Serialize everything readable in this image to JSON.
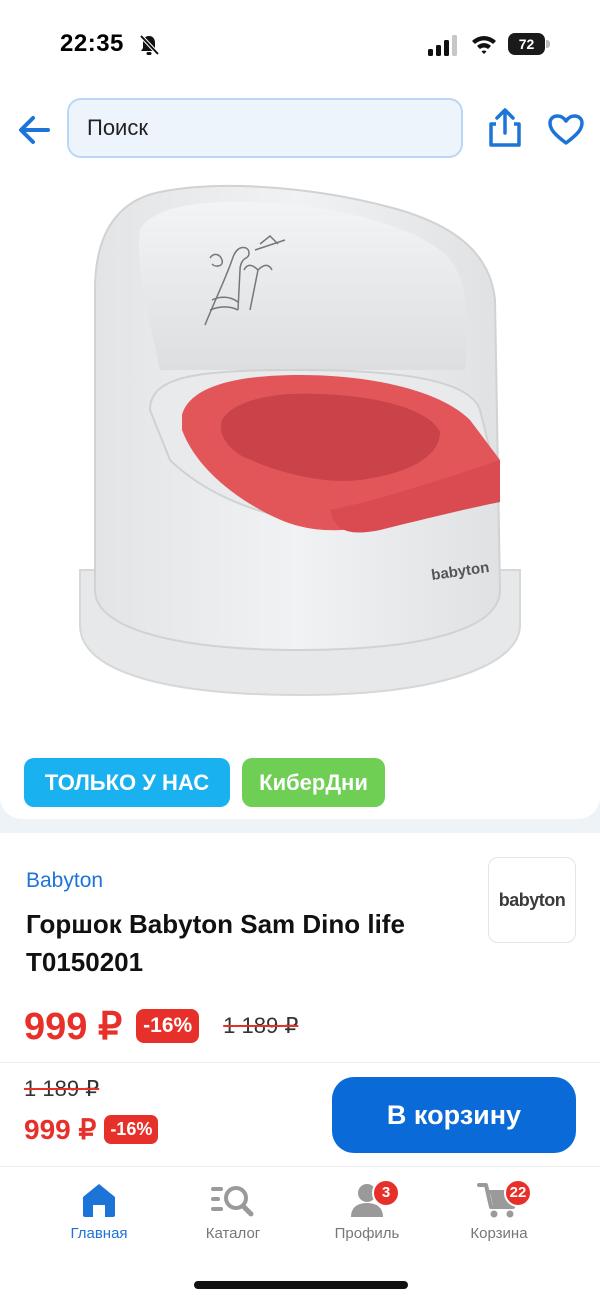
{
  "status_bar": {
    "time": "22:35",
    "battery_level": "72",
    "icons": [
      "bell-off-icon",
      "signal-icon",
      "wifi-icon",
      "battery-icon"
    ]
  },
  "header": {
    "search_placeholder": "Поиск",
    "icons": [
      "back-arrow-icon",
      "share-icon",
      "heart-icon"
    ],
    "accent_color": "#1d74d8"
  },
  "gallery": {
    "image_count": 5,
    "active_index": 0,
    "product_logo_text": "babyton"
  },
  "badges": {
    "exclusive": "ТОЛЬКО У НАС",
    "cyber": "КиберДни",
    "exclusive_color": "#1ab1f0",
    "cyber_color": "#6fcf55"
  },
  "product": {
    "brand": "Babyton",
    "brand_logo": "babyton",
    "title": "Горшок Babyton Sam Dino life T0150201",
    "price": "999 ₽",
    "discount": "-16%",
    "old_price": "1 189 ₽",
    "price_color": "#e8302a"
  },
  "buy_bar": {
    "old_price": "1 189 ₽",
    "price": "999 ₽",
    "discount": "-16%",
    "button_label": "В корзину",
    "button_color": "#0a6ad8"
  },
  "tab_bar": {
    "tabs": [
      {
        "label": "Главная",
        "icon": "home-icon",
        "active": true
      },
      {
        "label": "Каталог",
        "icon": "catalog-search-icon",
        "active": false
      },
      {
        "label": "Профиль",
        "icon": "profile-icon",
        "active": false,
        "badge": "3"
      },
      {
        "label": "Корзина",
        "icon": "cart-icon",
        "active": false,
        "badge": "22"
      }
    ]
  }
}
